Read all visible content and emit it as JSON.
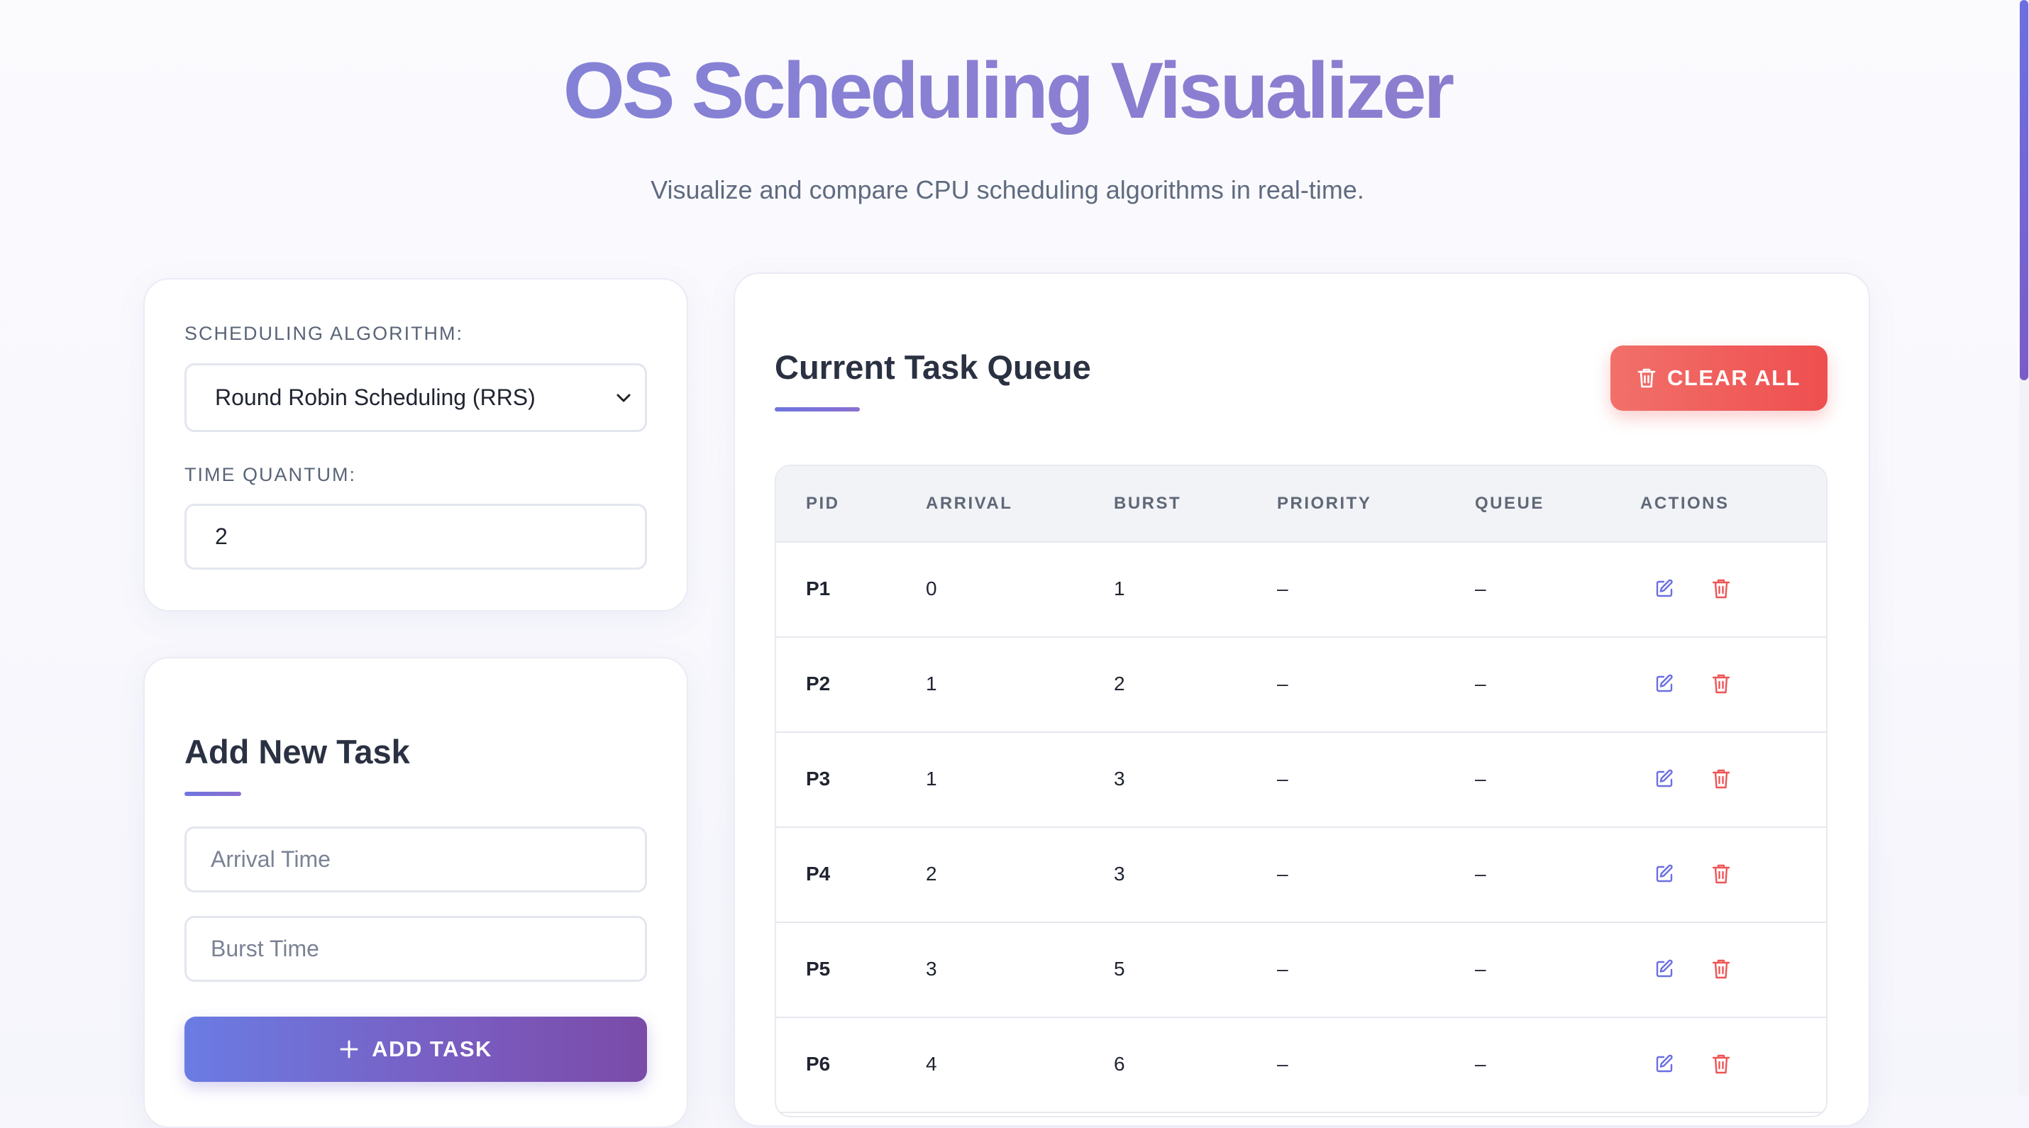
{
  "header": {
    "title": "OS Scheduling Visualizer",
    "subtitle": "Visualize and compare CPU scheduling algorithms in real-time."
  },
  "settings": {
    "algorithm_label": "SCHEDULING ALGORITHM:",
    "algorithm_value": "Round Robin Scheduling (RRS)",
    "quantum_label": "TIME QUANTUM:",
    "quantum_value": "2"
  },
  "add_task": {
    "title": "Add New Task",
    "arrival_placeholder": "Arrival Time",
    "burst_placeholder": "Burst Time",
    "button_label": "ADD TASK",
    "button_icon": "plus-icon"
  },
  "queue": {
    "title": "Current Task Queue",
    "clear_label": "CLEAR ALL",
    "clear_icon": "trash-icon",
    "columns": [
      "PID",
      "ARRIVAL",
      "BURST",
      "PRIORITY",
      "QUEUE",
      "ACTIONS"
    ],
    "rows": [
      {
        "pid": "P1",
        "arrival": "0",
        "burst": "1",
        "priority": "–",
        "queue": "–"
      },
      {
        "pid": "P2",
        "arrival": "1",
        "burst": "2",
        "priority": "–",
        "queue": "–"
      },
      {
        "pid": "P3",
        "arrival": "1",
        "burst": "3",
        "priority": "–",
        "queue": "–"
      },
      {
        "pid": "P4",
        "arrival": "2",
        "burst": "3",
        "priority": "–",
        "queue": "–"
      },
      {
        "pid": "P5",
        "arrival": "3",
        "burst": "5",
        "priority": "–",
        "queue": "–"
      },
      {
        "pid": "P6",
        "arrival": "4",
        "burst": "6",
        "priority": "–",
        "queue": "–"
      }
    ],
    "row_icons": [
      "edit-icon",
      "trash-icon"
    ]
  },
  "colors": {
    "accent": "#7b7fdc",
    "danger": "#ee5555",
    "edit_icon": "#6b6fe0"
  }
}
